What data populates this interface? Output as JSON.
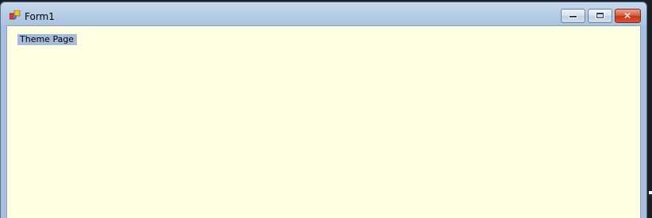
{
  "window": {
    "title": "Form1",
    "icon": "form-app-icon",
    "controls": {
      "minimize": "minimize-icon",
      "maximize": "maximize-icon",
      "close": "close-icon"
    },
    "client_background": "#ffffe3"
  },
  "client": {
    "label_text": "Theme Page",
    "label_background": "#a6bcd8"
  }
}
